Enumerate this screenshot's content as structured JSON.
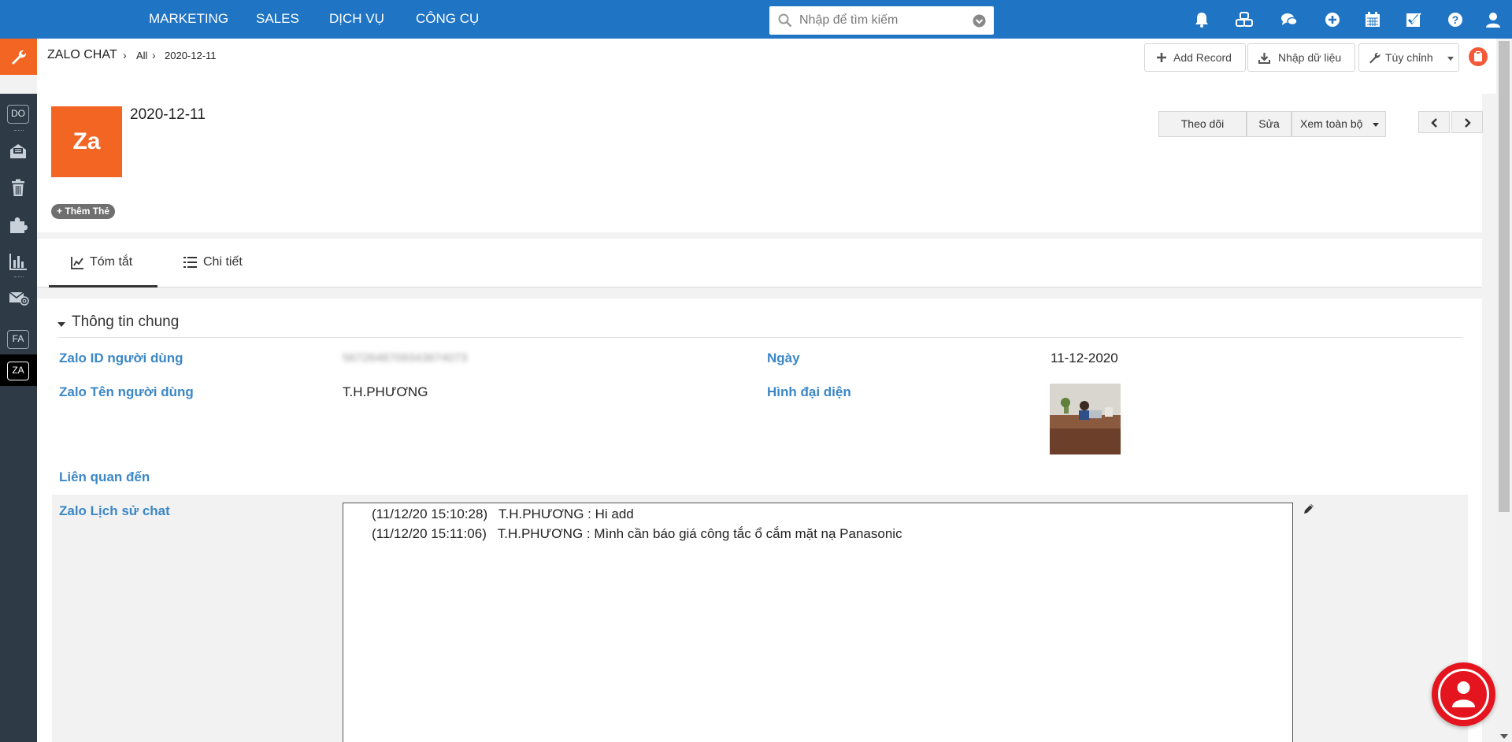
{
  "nav": {
    "items": [
      "MARKETING",
      "SALES",
      "DỊCH VỤ",
      "CÔNG CỤ"
    ],
    "search_placeholder": "Nhập để tìm kiếm",
    "icons": [
      "bell-icon",
      "cubes-icon",
      "comments-icon",
      "plus-circle-icon",
      "calendar-icon",
      "checkbox-icon",
      "help-icon",
      "user-icon"
    ]
  },
  "sidebar": {
    "items": [
      "DO",
      "inbox",
      "trash",
      "puzzle",
      "chart",
      "email",
      "FA",
      "ZA"
    ],
    "active": "ZA"
  },
  "breadcrumb": {
    "module": "ZALO CHAT",
    "filter": "All",
    "record": "2020-12-11"
  },
  "toolbar": {
    "add_record": "Add Record",
    "import": "Nhập dữ liệu",
    "customize": "Tùy chỉnh"
  },
  "record": {
    "logo_text": "Za",
    "title": "2020-12-11",
    "add_tag": "Thêm Thẻ",
    "follow": "Theo dõi",
    "edit": "Sửa",
    "view_all": "Xem toàn bộ"
  },
  "tabs": {
    "summary": "Tóm tắt",
    "detail": "Chi tiết"
  },
  "section": {
    "title": "Thông tin chung",
    "fields": {
      "zalo_id_label": "Zalo ID người dùng",
      "zalo_id_value": "5672648709343674073",
      "date_label": "Ngày",
      "date_value": "11-12-2020",
      "name_label": "Zalo Tên người dùng",
      "name_value": "T.H.PHƯƠNG",
      "avatar_label": "Hình đại diện",
      "related_label": "Liên quan đến",
      "history_label": "Zalo Lịch sử chat"
    },
    "chat": [
      "(11/12/20 15:10:28)   T.H.PHƯƠNG : Hi add",
      "(11/12/20 15:11:06)   T.H.PHƯƠNG : Mình cần báo giá công tắc ổ cắm mặt nạ Panasonic"
    ]
  },
  "colors": {
    "nav_bg": "#1f74c4",
    "accent_orange": "#f26522",
    "sidebar_bg": "#2e3a46",
    "label_blue": "#3b87c6",
    "fab_red": "#e4151f"
  }
}
